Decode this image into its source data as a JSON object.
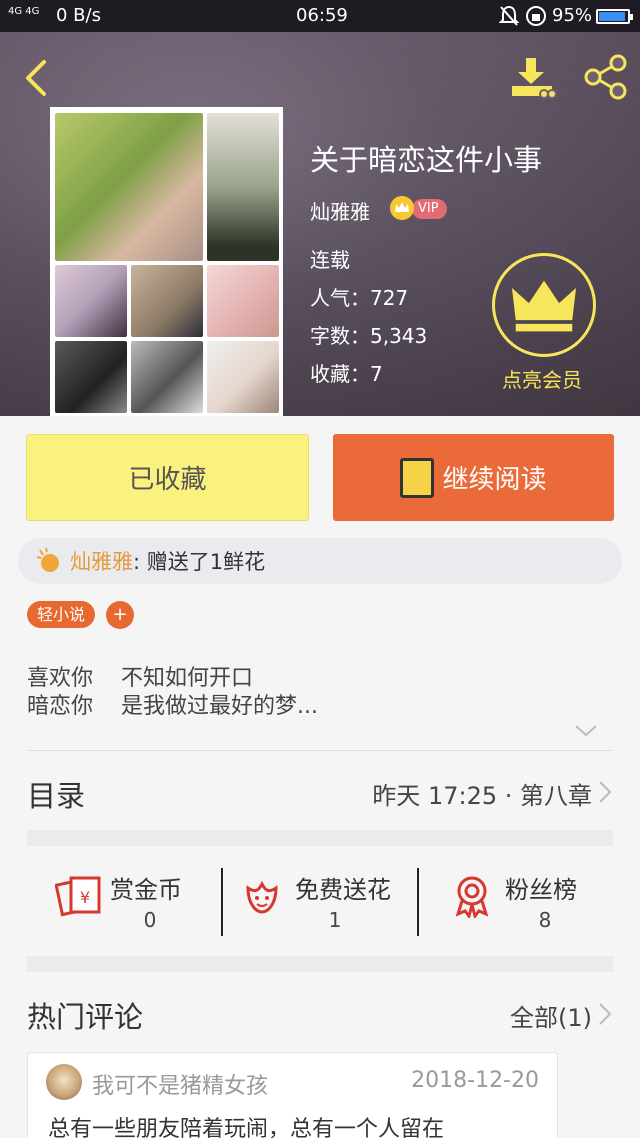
{
  "status_bar": {
    "signal": "4G 4G",
    "net_speed": "0 B/s",
    "time": "06:59",
    "battery": "95%"
  },
  "book": {
    "title": "关于暗恋这件小事",
    "author": "灿雅雅",
    "vip_tag": "VIP",
    "status": "连载",
    "popularity": "人气：727",
    "word_count": "字数：5,343",
    "favorites": "收藏：7",
    "vip_badge_label": "点亮会员"
  },
  "actions": {
    "collected_label": "已收藏",
    "continue_label": "继续阅读"
  },
  "gift_notice": {
    "name": "灿雅雅",
    "text": ": 赠送了1鲜花"
  },
  "tags": {
    "category": "轻小说",
    "add": "+"
  },
  "description": {
    "line1": "喜欢你    不知如何开口",
    "line2": "暗恋你    是我做过最好的梦..."
  },
  "catalog": {
    "title": "目录",
    "latest": "昨天 17:25 · 第八章"
  },
  "stats": [
    {
      "label": "赏金币",
      "value": "0",
      "icon": "red-envelope-icon"
    },
    {
      "label": "免费送花",
      "value": "1",
      "icon": "flower-icon"
    },
    {
      "label": "粉丝榜",
      "value": "8",
      "icon": "medal-icon"
    }
  ],
  "hot_comments": {
    "title": "热门评论",
    "all": "全部(1)"
  },
  "comment": {
    "user": "我可不是猪精女孩",
    "date": "2018-12-20",
    "text": "总有一些朋友陪着玩闹，总有一个人留在"
  },
  "colors": {
    "accent_orange": "#eb6a3a",
    "accent_yellow": "#fbf17e",
    "vip_gold": "#f7e55b",
    "icon_red": "#d6372f"
  }
}
